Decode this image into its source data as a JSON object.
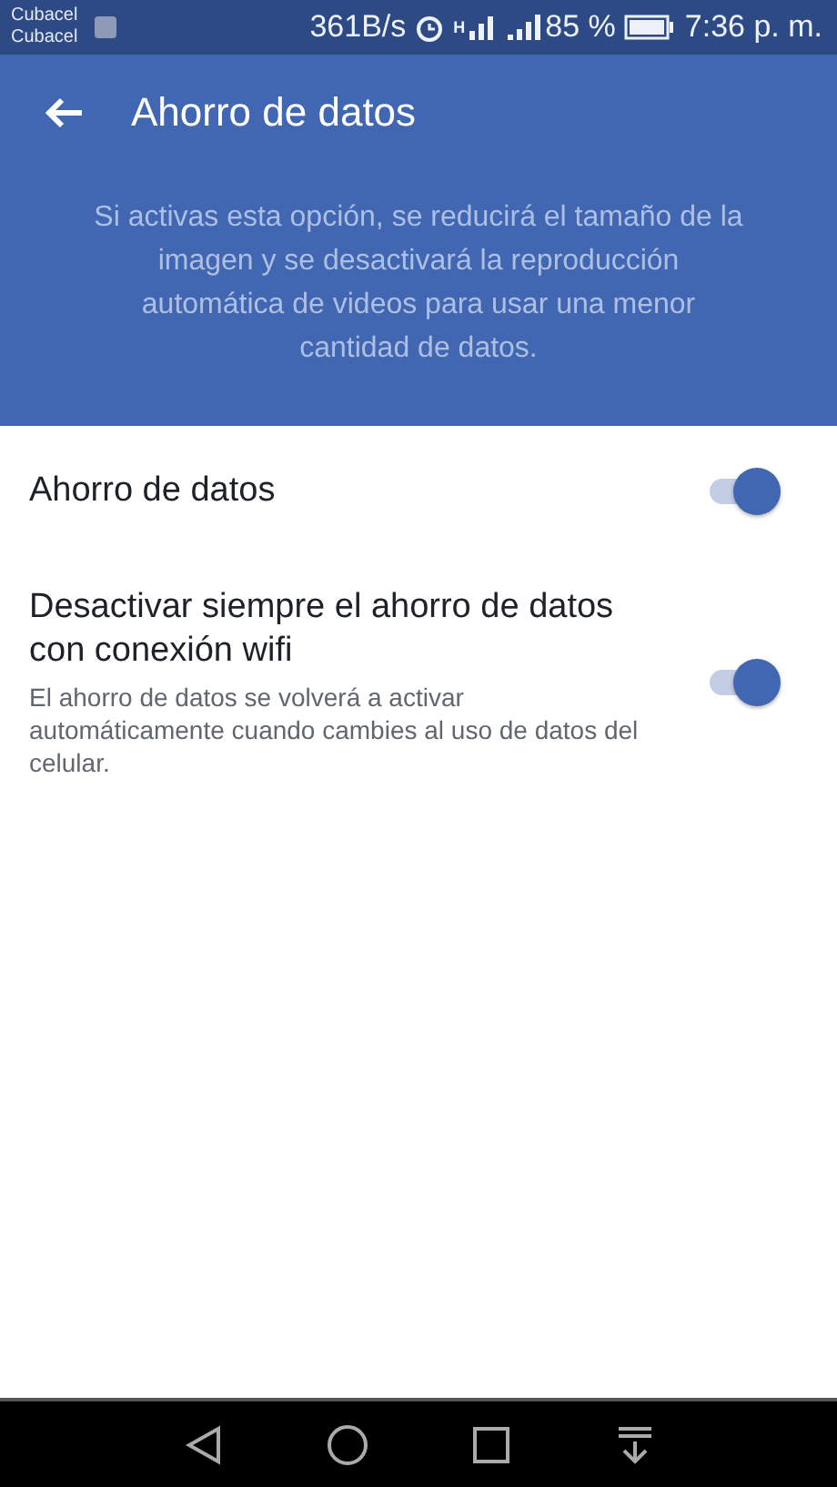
{
  "status_bar": {
    "carriers": [
      "Cubacel",
      "Cubacel"
    ],
    "speed": "361B/s",
    "network_type": "H",
    "battery": "85 %",
    "time": "7:36 p. m."
  },
  "header": {
    "title": "Ahorro de datos",
    "description": "Si activas esta opción, se reducirá el tamaño de la imagen y se desactivará la reproducción automática de videos para usar una menor cantidad de datos."
  },
  "settings": [
    {
      "title": "Ahorro de datos",
      "on": true
    },
    {
      "title": "Desactivar siempre el ahorro de datos con conexión wifi",
      "description": "El ahorro de datos se volverá a activar automáticamente cuando cambies al uso de datos del celular.",
      "on": true
    }
  ]
}
